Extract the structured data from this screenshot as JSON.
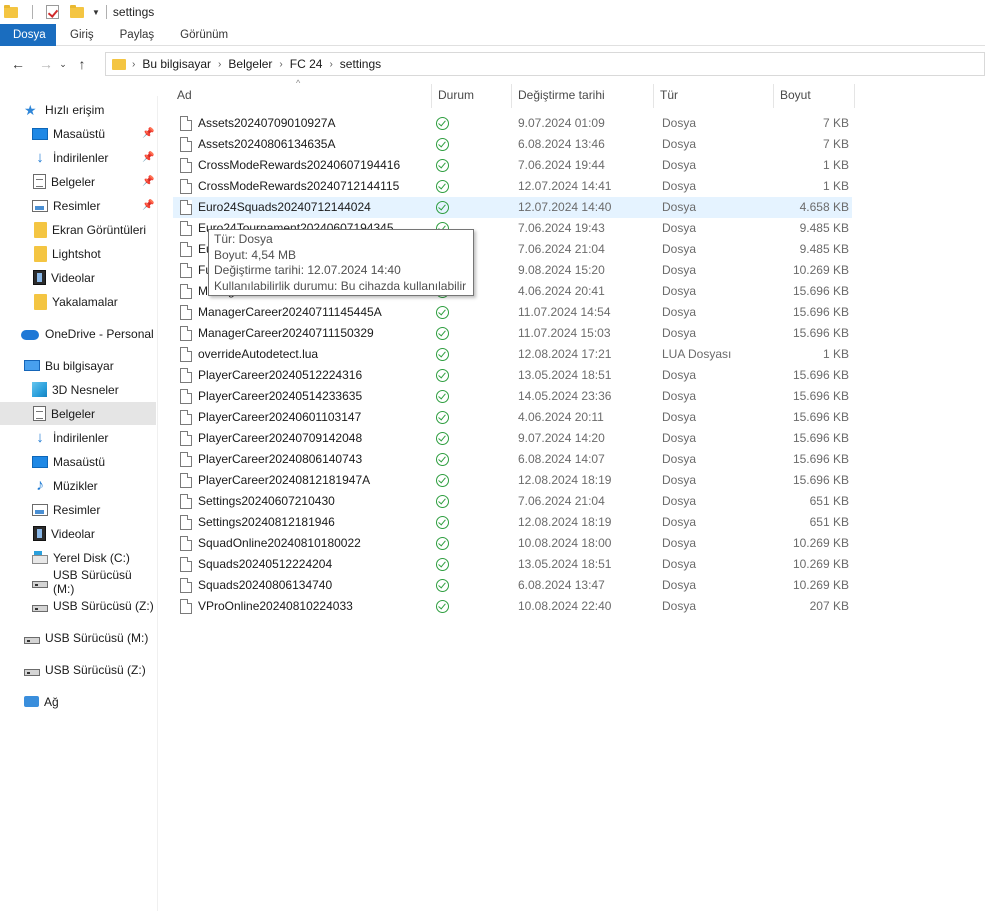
{
  "window": {
    "title": "settings"
  },
  "ribbon": {
    "tabs": [
      "Dosya",
      "Giriş",
      "Paylaş",
      "Görünüm"
    ]
  },
  "address": {
    "crumbs": [
      "Bu bilgisayar",
      "Belgeler",
      "FC 24",
      "settings"
    ]
  },
  "sidebar": {
    "quick_access": "Hızlı erişim",
    "items": [
      {
        "label": "Masaüstü",
        "icon": "desktop-icon",
        "pinned": true
      },
      {
        "label": "İndirilenler",
        "icon": "downloads-icon",
        "pinned": true
      },
      {
        "label": "Belgeler",
        "icon": "documents-icon",
        "pinned": true
      },
      {
        "label": "Resimler",
        "icon": "pictures-icon",
        "pinned": true
      },
      {
        "label": "Ekran Görüntüleri",
        "icon": "folder-icon"
      },
      {
        "label": "Lightshot",
        "icon": "folder-icon"
      },
      {
        "label": "Videolar",
        "icon": "videos-icon"
      },
      {
        "label": "Yakalamalar",
        "icon": "folder-icon"
      }
    ],
    "onedrive": "OneDrive - Personal",
    "this_pc": "Bu bilgisayar",
    "pc_items": [
      {
        "label": "3D Nesneler",
        "icon": "3d-objects-icon"
      },
      {
        "label": "Belgeler",
        "icon": "documents-icon",
        "selected": true
      },
      {
        "label": "İndirilenler",
        "icon": "downloads-icon"
      },
      {
        "label": "Masaüstü",
        "icon": "desktop-icon"
      },
      {
        "label": "Müzikler",
        "icon": "music-icon"
      },
      {
        "label": "Resimler",
        "icon": "pictures-icon"
      },
      {
        "label": "Videolar",
        "icon": "videos-icon"
      },
      {
        "label": "Yerel Disk (C:)",
        "icon": "local-disk-icon"
      },
      {
        "label": "USB Sürücüsü (M:)",
        "icon": "usb-drive-icon"
      },
      {
        "label": "USB Sürücüsü (Z:)",
        "icon": "usb-drive-icon"
      }
    ],
    "usb_m": "USB Sürücüsü (M:)",
    "usb_z": "USB Sürücüsü (Z:)",
    "network": "Ağ"
  },
  "columns": {
    "name": "Ad",
    "status": "Durum",
    "date": "Değiştirme tarihi",
    "type": "Tür",
    "size": "Boyut"
  },
  "files": [
    {
      "name": "Assets20240709010927A",
      "date": "9.07.2024 01:09",
      "type": "Dosya",
      "size": "7 KB"
    },
    {
      "name": "Assets20240806134635A",
      "date": "6.08.2024 13:46",
      "type": "Dosya",
      "size": "7 KB"
    },
    {
      "name": "CrossModeRewards20240607194416",
      "date": "7.06.2024 19:44",
      "type": "Dosya",
      "size": "1 KB"
    },
    {
      "name": "CrossModeRewards20240712144115",
      "date": "12.07.2024 14:41",
      "type": "Dosya",
      "size": "1 KB"
    },
    {
      "name": "Euro24Squads20240712144024",
      "date": "12.07.2024 14:40",
      "type": "Dosya",
      "size": "4.658 KB",
      "highlighted": true
    },
    {
      "name": "Euro24Tournament20240607194345",
      "date": "7.06.2024 19:43",
      "type": "Dosya",
      "size": "9.485 KB"
    },
    {
      "name": "Eu",
      "date": "7.06.2024 21:04",
      "type": "Dosya",
      "size": "9.485 KB"
    },
    {
      "name": "Fu",
      "date": "9.08.2024 15:20",
      "type": "Dosya",
      "size": "10.269 KB"
    },
    {
      "name": "ManagerCareer20240604204120",
      "date": "4.06.2024 20:41",
      "type": "Dosya",
      "size": "15.696 KB"
    },
    {
      "name": "ManagerCareer20240711145445A",
      "date": "11.07.2024 14:54",
      "type": "Dosya",
      "size": "15.696 KB"
    },
    {
      "name": "ManagerCareer20240711150329",
      "date": "11.07.2024 15:03",
      "type": "Dosya",
      "size": "15.696 KB"
    },
    {
      "name": "overrideAutodetect.lua",
      "date": "12.08.2024 17:21",
      "type": "LUA Dosyası",
      "size": "1 KB"
    },
    {
      "name": "PlayerCareer20240512224316",
      "date": "13.05.2024 18:51",
      "type": "Dosya",
      "size": "15.696 KB"
    },
    {
      "name": "PlayerCareer20240514233635",
      "date": "14.05.2024 23:36",
      "type": "Dosya",
      "size": "15.696 KB"
    },
    {
      "name": "PlayerCareer20240601103147",
      "date": "4.06.2024 20:11",
      "type": "Dosya",
      "size": "15.696 KB"
    },
    {
      "name": "PlayerCareer20240709142048",
      "date": "9.07.2024 14:20",
      "type": "Dosya",
      "size": "15.696 KB"
    },
    {
      "name": "PlayerCareer20240806140743",
      "date": "6.08.2024 14:07",
      "type": "Dosya",
      "size": "15.696 KB"
    },
    {
      "name": "PlayerCareer20240812181947A",
      "date": "12.08.2024 18:19",
      "type": "Dosya",
      "size": "15.696 KB"
    },
    {
      "name": "Settings20240607210430",
      "date": "7.06.2024 21:04",
      "type": "Dosya",
      "size": "651 KB"
    },
    {
      "name": "Settings20240812181946",
      "date": "12.08.2024 18:19",
      "type": "Dosya",
      "size": "651 KB"
    },
    {
      "name": "SquadOnline20240810180022",
      "date": "10.08.2024 18:00",
      "type": "Dosya",
      "size": "10.269 KB"
    },
    {
      "name": "Squads20240512224204",
      "date": "13.05.2024 18:51",
      "type": "Dosya",
      "size": "10.269 KB"
    },
    {
      "name": "Squads20240806134740",
      "date": "6.08.2024 13:47",
      "type": "Dosya",
      "size": "10.269 KB"
    },
    {
      "name": "VProOnline20240810224033",
      "date": "10.08.2024 22:40",
      "type": "Dosya",
      "size": "207 KB"
    }
  ],
  "tooltip": {
    "type": "Tür: Dosya",
    "size": "Boyut: 4,54 MB",
    "date": "Değiştirme tarihi: 12.07.2024 14:40",
    "availability": "Kullanılabilirlik durumu: Bu cihazda kullanılabilir"
  }
}
